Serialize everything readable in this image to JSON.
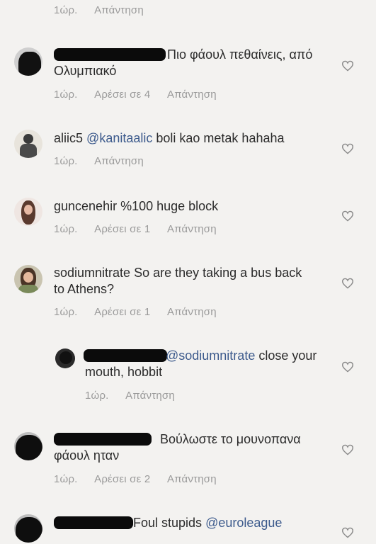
{
  "comments": [
    {
      "time": "1ώρ.",
      "reply": "Απάντηση"
    },
    {
      "user": "",
      "text": "Πιο φάουλ πεθαίνεις, από Ολυμπιακό",
      "time": "1ώρ.",
      "likes": "Αρέσει σε 4",
      "reply": "Απάντηση"
    },
    {
      "user": "aliic5",
      "mention": "@kanitaalic",
      "text": " boli kao metak hahaha",
      "time": "1ώρ.",
      "reply": "Απάντηση"
    },
    {
      "user": "guncenehir",
      "text": " %100 huge block",
      "time": "1ώρ.",
      "likes": "Αρέσει σε 1",
      "reply": "Απάντηση"
    },
    {
      "user": "sodiumnitrate",
      "text": " So are they taking a bus back to Athens?",
      "time": "1ώρ.",
      "likes": "Αρέσει σε 1",
      "reply": "Απάντηση"
    },
    {
      "user": "",
      "mention": "@sodiumnitrate",
      "text": "  close your mouth, hobbit",
      "time": "1ώρ.",
      "reply": "Απάντηση"
    },
    {
      "user": "",
      "text": "Βούλωστε το μουνοπανα φάουλ ηταν",
      "time": "1ώρ.",
      "likes": "Αρέσει σε 2",
      "reply": "Απάντηση"
    },
    {
      "user": "",
      "text": "Foul  stupids ",
      "mention": "@euroleague"
    }
  ],
  "icons": {
    "like": "heart-outline-icon"
  },
  "colors": {
    "background": "#f3f2f0",
    "meta": "#9a9a9a",
    "mention": "#3c5a8c"
  }
}
